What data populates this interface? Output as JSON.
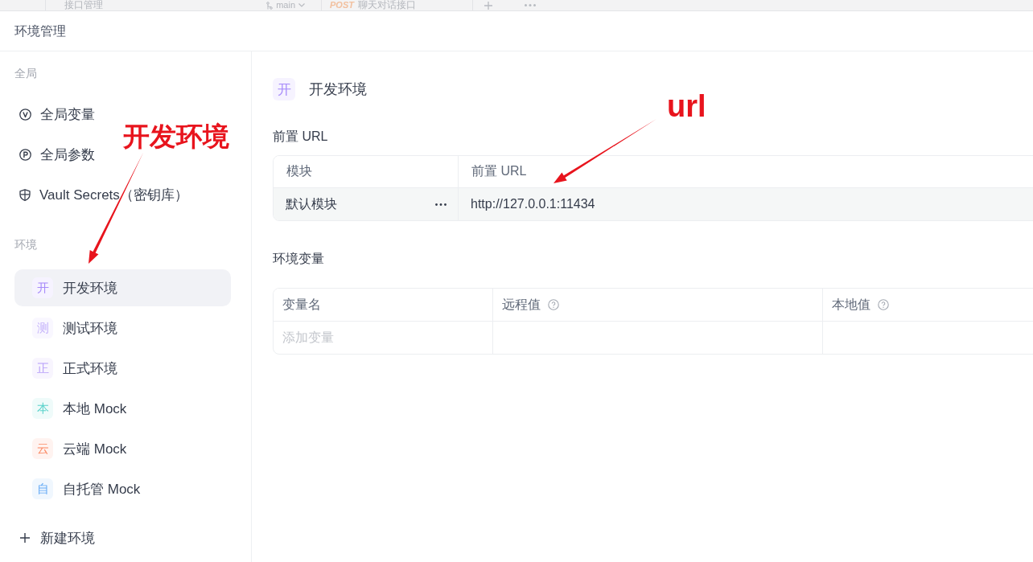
{
  "background_toolbar": {
    "title": "接口管理",
    "branch": "main",
    "request_tab": {
      "method": "POST",
      "name": "聊天对话接口"
    }
  },
  "dialog": {
    "title": "环境管理"
  },
  "sidebar": {
    "global_section": {
      "label": "全局",
      "items": [
        {
          "kind": "variable",
          "label": "全局变量"
        },
        {
          "kind": "parameter",
          "label": "全局参数"
        },
        {
          "kind": "vault",
          "label": "Vault Secrets（密钥库）"
        }
      ]
    },
    "environment_section": {
      "label": "环境",
      "items": [
        {
          "badge": "开",
          "name": "开发环境",
          "color": "#a78bfa",
          "selected": true
        },
        {
          "badge": "测",
          "name": "测试环境",
          "color": "#c4b2fb",
          "selected": false
        },
        {
          "badge": "正",
          "name": "正式环境",
          "color": "#b79ff9",
          "selected": false
        },
        {
          "badge": "本",
          "name": "本地 Mock",
          "color": "#5dd3cc",
          "selected": false
        },
        {
          "badge": "云",
          "name": "云端 Mock",
          "color": "#fb8b66",
          "selected": false
        },
        {
          "badge": "自",
          "name": "自托管 Mock",
          "color": "#68acf6",
          "selected": false
        }
      ]
    },
    "new_environment": {
      "label": "新建环境"
    }
  },
  "main": {
    "title": {
      "badge": "开",
      "text": "开发环境",
      "color": "#a78bfa"
    },
    "prefix_url": {
      "heading": "前置 URL",
      "columns": [
        "模块",
        "前置 URL"
      ],
      "rows": [
        {
          "module": "默认模块",
          "url": "http://127.0.0.1:11434"
        }
      ]
    },
    "variables": {
      "heading": "环境变量",
      "columns": [
        {
          "label": "变量名",
          "help": false
        },
        {
          "label": "远程值",
          "help": true
        },
        {
          "label": "本地值",
          "help": true
        }
      ],
      "placeholder": "添加变量"
    }
  },
  "annotations": [
    {
      "text": "开发环境"
    },
    {
      "text": "url"
    }
  ]
}
